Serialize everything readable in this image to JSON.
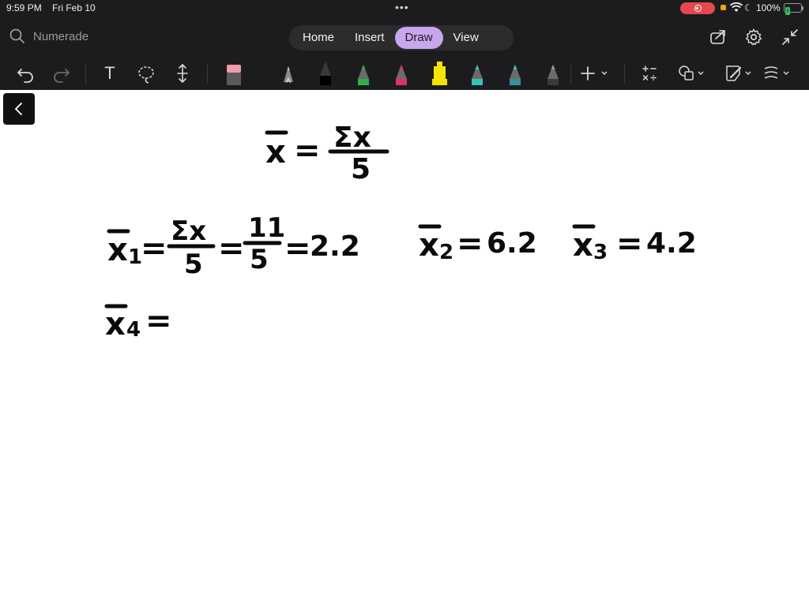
{
  "status": {
    "time": "9:59 PM",
    "date": "Fri Feb 10",
    "battery": "100%"
  },
  "search": {
    "placeholder": "Numerade"
  },
  "tabs": [
    {
      "label": "Home"
    },
    {
      "label": "Insert"
    },
    {
      "label": "Draw",
      "active": true
    },
    {
      "label": "View"
    }
  ],
  "colors": {
    "chrome": "#1c1c1e",
    "active_tab": "#c8a7ec",
    "recording": "#e5484d",
    "battery": "#34c759",
    "highlighter": "#f5e400",
    "pen_green": "#2fb344",
    "pen_pink": "#e0306f",
    "pen_teal": "#34c3b5"
  },
  "toolbar": {
    "icons": [
      "undo-icon",
      "redo-icon",
      "text-icon",
      "lasso-icon",
      "insert-space-icon",
      "eraser-icon",
      "pen-with-a-icon",
      "black-pen-icon",
      "green-pen-icon",
      "pink-pen-icon",
      "yellow-highlighter-icon",
      "teal-pen-icon",
      "green-pen-2-icon",
      "gray-pen-icon",
      "add-icon",
      "math-icon",
      "shapes-icon",
      "ink-to-shape-icon",
      "ruler-icon"
    ],
    "text_tool_glyph": "T",
    "pen_a_glyph": "A"
  },
  "canvas": {
    "line_mean": {
      "lhs": "x̄",
      "eq": "=",
      "num": "Σx",
      "den": "5"
    },
    "line_x1": {
      "lhs": "x̄",
      "sub": "1",
      "num1": "Σx",
      "den1": "5",
      "num2": "11",
      "den2": "5",
      "result": "2.2"
    },
    "line_x2": {
      "lhs": "x̄",
      "sub": "2",
      "result": "6.2"
    },
    "line_x3": {
      "lhs": "x̄",
      "sub": "3",
      "result": "4.2"
    },
    "line_x4": {
      "lhs": "x̄",
      "sub": "4"
    },
    "equals": "="
  }
}
